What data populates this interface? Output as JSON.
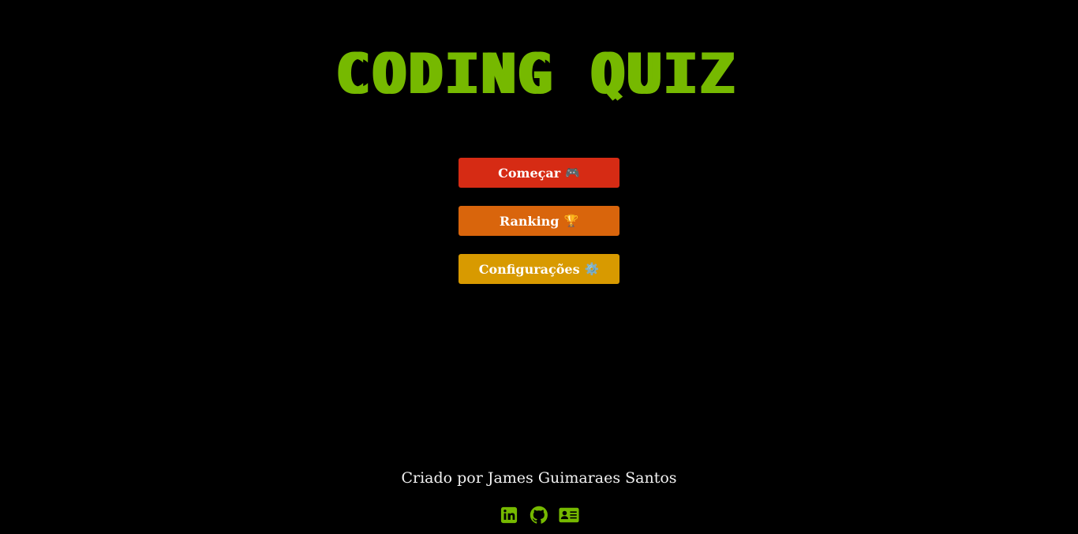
{
  "title": "CODING QUIZ",
  "menu": {
    "start_label": "Começar",
    "start_emoji": "🎮",
    "ranking_label": "Ranking",
    "ranking_emoji": "🏆",
    "settings_label": "Configurações",
    "settings_emoji": "⚙️"
  },
  "footer": {
    "credit": "Criado por James Guimaraes Santos"
  },
  "social": [
    {
      "icon": "linkedin-icon"
    },
    {
      "icon": "github-icon"
    },
    {
      "icon": "contact-card-icon"
    }
  ],
  "colors": {
    "background": "#000000",
    "title": "#76b900",
    "start_button": "#d62b14",
    "ranking_button": "#d9650c",
    "settings_button": "#d89a00",
    "footer_text": "#f2f2f2",
    "icon": "#76b900"
  }
}
